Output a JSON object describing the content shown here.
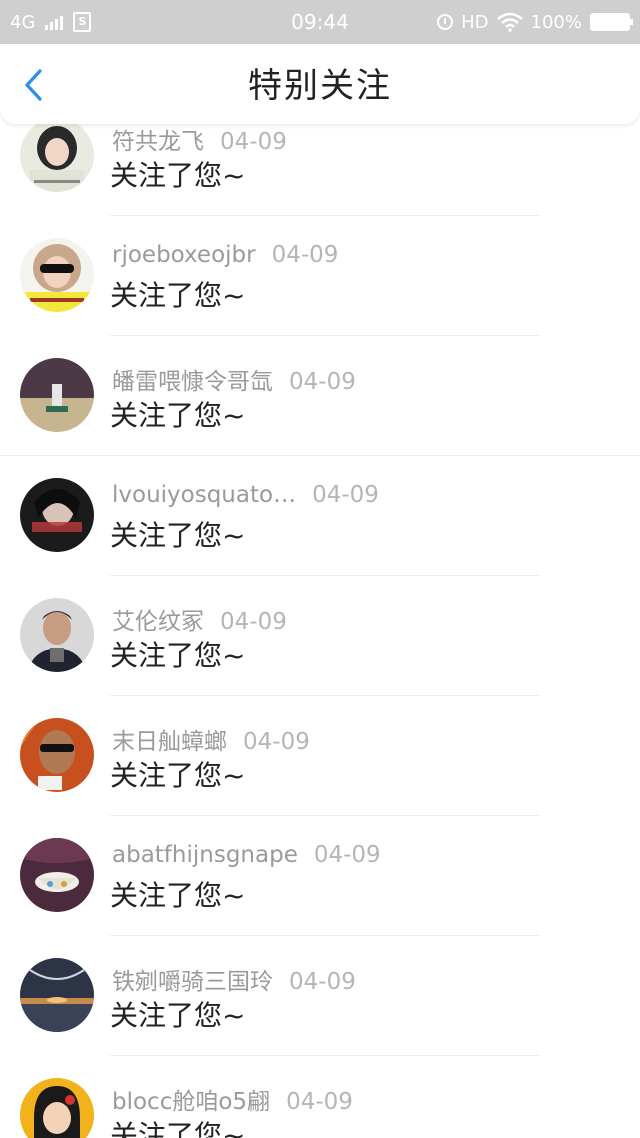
{
  "status_bar": {
    "network": "4G",
    "time": "09:44",
    "hd": "HD",
    "battery": "100%"
  },
  "nav": {
    "title": "特别关注"
  },
  "items": [
    {
      "name": "符共龙飞",
      "date": "04-09",
      "message": "关注了您~"
    },
    {
      "name": "rjoeboxeojbr",
      "date": "04-09",
      "message": "关注了您~"
    },
    {
      "name": "皤雷喂慷令哥氙",
      "date": "04-09",
      "message": "关注了您~"
    },
    {
      "name": "lvouiyosquato…",
      "date": "04-09",
      "message": "关注了您~"
    },
    {
      "name": "艾伦纹冢",
      "date": "04-09",
      "message": "关注了您~"
    },
    {
      "name": "末日舢蟑螂",
      "date": "04-09",
      "message": "关注了您~"
    },
    {
      "name": "abatfhijnsgnape",
      "date": "04-09",
      "message": "关注了您~"
    },
    {
      "name": "铁剜嚼骑三国玲",
      "date": "04-09",
      "message": "关注了您~"
    },
    {
      "name": "blocc舱咱o5翩",
      "date": "04-09",
      "message": "关注了您~"
    }
  ],
  "colors": {
    "accent": "#2a8ef0",
    "status_bar_bg": "#cfcfcf",
    "name_text": "#9a9a9a",
    "message_text": "#222222"
  }
}
